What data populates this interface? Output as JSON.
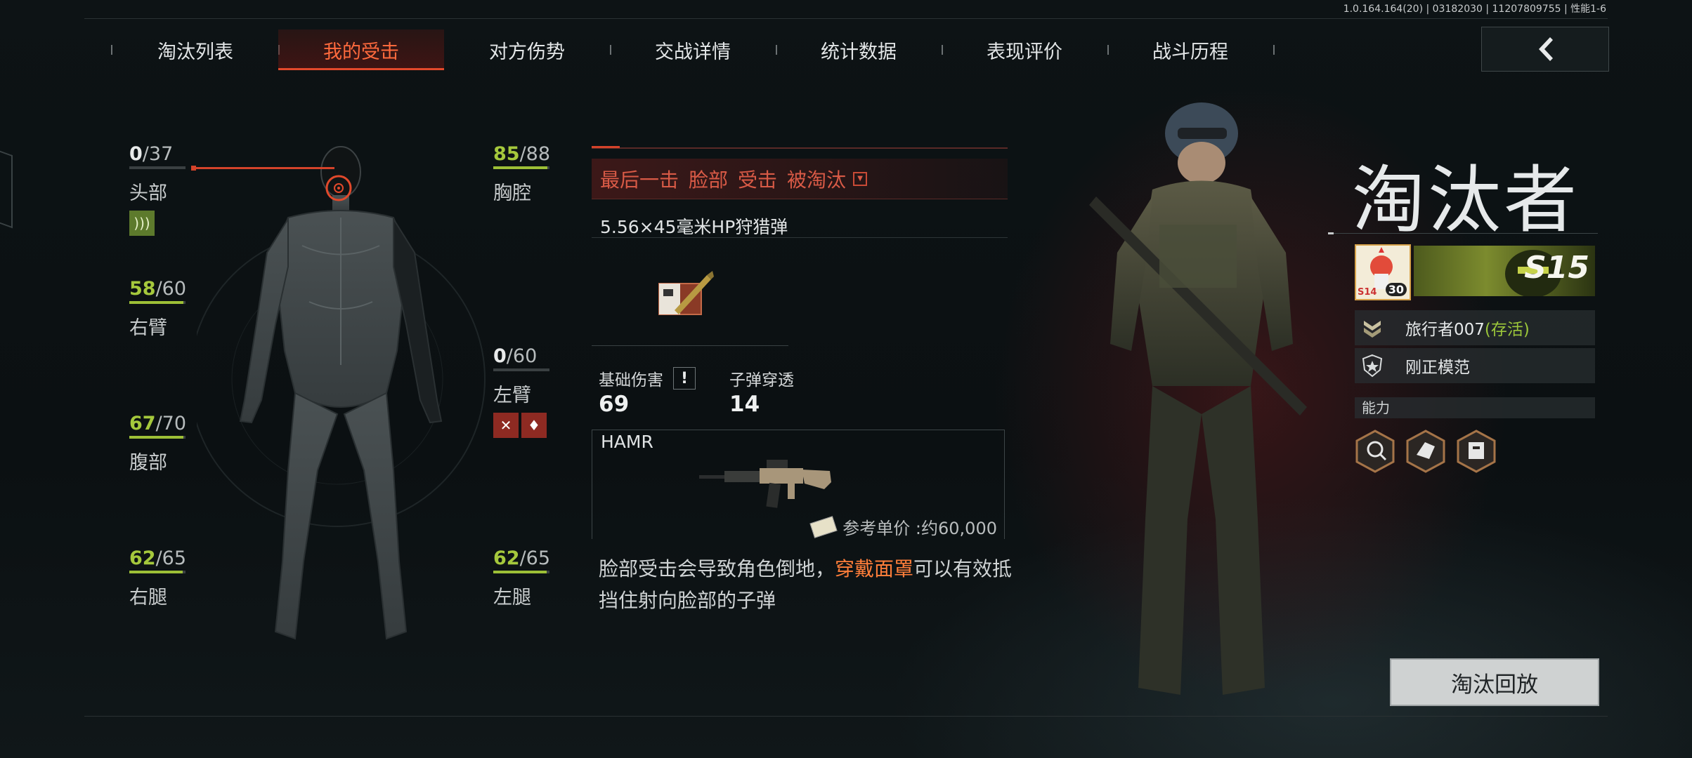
{
  "version": "1.0.164.164(20) | 03182030 | 11207809755 | 性能1-6",
  "tabs": [
    {
      "label": "淘汰列表"
    },
    {
      "label": "我的受击"
    },
    {
      "label": "对方伤势"
    },
    {
      "label": "交战详情"
    },
    {
      "label": "统计数据"
    },
    {
      "label": "表现评价"
    },
    {
      "label": "战斗历程"
    }
  ],
  "active_tab": 1,
  "body_parts": {
    "head": {
      "current": "0",
      "max": "/37",
      "label": "头部",
      "fill": 0
    },
    "chest": {
      "current": "85",
      "max": "/88",
      "label": "胸腔",
      "fill": 0.966
    },
    "right_arm": {
      "current": "58",
      "max": "/60",
      "label": "右臂",
      "fill": 0.967
    },
    "left_arm": {
      "current": "0",
      "max": "/60",
      "label": "左臂",
      "fill": 0
    },
    "abdomen": {
      "current": "67",
      "max": "/70",
      "label": "腹部",
      "fill": 0.957
    },
    "right_leg": {
      "current": "62",
      "max": "/65",
      "label": "右腿",
      "fill": 0.954
    },
    "left_leg": {
      "current": "62",
      "max": "/65",
      "label": "左腿",
      "fill": 0.954
    }
  },
  "kill_info": {
    "final_hit": "最后一击",
    "part": "脸部",
    "hit": "受击",
    "eliminated": "被淘汰"
  },
  "ammo": {
    "name": "5.56×45毫米HP狩猎弹"
  },
  "damage": {
    "base_label": "基础伤害",
    "base_value": "69",
    "pen_label": "子弹穿透",
    "pen_value": "14"
  },
  "weapon": {
    "name": "HAMR",
    "price": "参考单价 :约60,000"
  },
  "tip": {
    "before": "脸部受击会导致角色倒地，",
    "highlight": "穿戴面罩",
    "after": "可以有效抵挡住射向脸部的子弹"
  },
  "killer": {
    "title": "淘汰者",
    "badge_level": "30",
    "badge_season": "S14",
    "season": "S15",
    "player_name": "旅行者007",
    "status": "(存活)",
    "title_badge": "刚正模范",
    "ability_label": "能力",
    "abilities": [
      "I",
      "II",
      "IV"
    ]
  },
  "replay_button": "淘汰回放",
  "colors": {
    "accent": "#e2492b",
    "health_green": "#9dbf36",
    "alive_green": "#9bc63a",
    "tip_highlight": "#ff7e3a"
  }
}
